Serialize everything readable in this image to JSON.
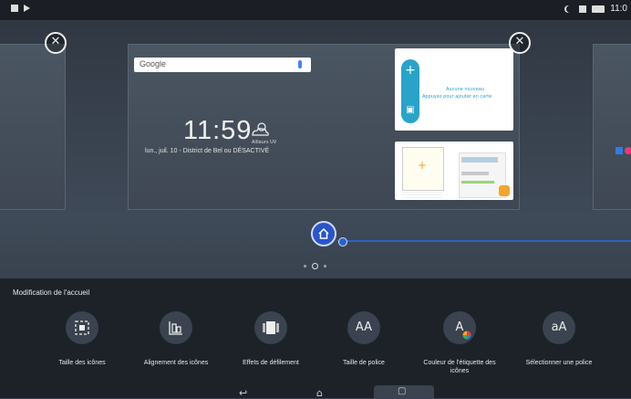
{
  "status_bar": {
    "time": "11:0"
  },
  "google_search": {
    "logo": "Google"
  },
  "clock_widget": {
    "time": "11:59",
    "weather_label": "Ailleurs UV",
    "date_line": "lun., juil. 10 - District de Bel ou  DÉSACTIVÉ"
  },
  "quick_memo_widget": {
    "line1": "Aucune nouveau",
    "line2": "Appuyez pour ajouter en carte"
  },
  "memo_card": {
    "plus": "+"
  },
  "home_settings": {
    "title": "Modification de l'accueil",
    "options": [
      {
        "label": "Taille des icônes",
        "icon": "icon-size-icon"
      },
      {
        "label": "Alignement des icônes",
        "icon": "icon-align-icon"
      },
      {
        "label": "Effets de défilement",
        "icon": "scroll-effects-icon"
      },
      {
        "label": "Taille de police",
        "icon": "font-size-icon",
        "glyph": "AA"
      },
      {
        "label": "Couleur de l'étiquette des icônes",
        "icon": "label-color-icon",
        "glyph": "A"
      },
      {
        "label": "Sélectionner une police",
        "icon": "font-select-icon",
        "glyph": "aA"
      }
    ]
  },
  "colors": {
    "accent": "#2a55c9",
    "panel": "#1d2229",
    "memo_blue": "#29a3c9"
  }
}
